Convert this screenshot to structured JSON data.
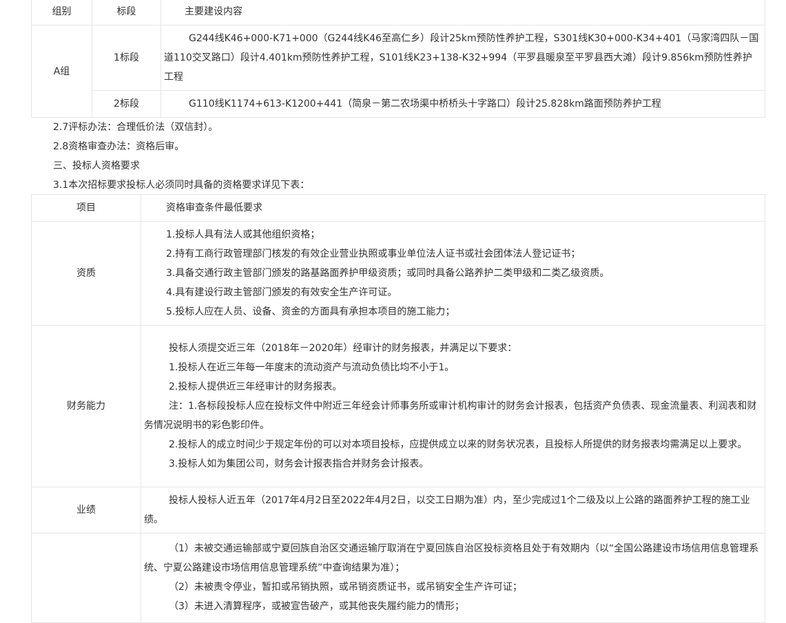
{
  "table1": {
    "headers": [
      "组别",
      "标段",
      "主要建设内容"
    ],
    "group": "A组",
    "rows": [
      {
        "section": "1标段",
        "content": "G244线K46+000-K71+000（G244线K46至高仁乡）段计25km预防性养护工程，S301线K30+000-K34+401（马家湾四队－国道110交叉路口）段计4.401km预防性养护工程，S101线K23+138-K32+994（平罗县暖泉至平罗县西大滩）段计9.856km预防性养护工程"
      },
      {
        "section": "2标段",
        "content": "G110线K1174+613-K1200+441（简泉－第二农场渠中桥桥头十字路口）段计25.828km路面预防养护工程"
      }
    ]
  },
  "paragraphs": [
    "2.7评标办法：合理低价法（双信封）。",
    "2.8资格审查办法：资格后审。",
    "三、投标人资格要求",
    "3.1本次招标要求投标人必须同时具备的资格要求详见下表："
  ],
  "table2": {
    "headers": [
      "项目",
      "资格审查条件最低要求"
    ],
    "rows": [
      {
        "item": "资质",
        "lines": [
          "1.投标人具有法人或其他组织资格；",
          "2.持有工商行政管理部门核发的有效企业营业执照或事业单位法人证书或社会团体法人登记证书；",
          "3.具备交通行政主管部门颁发的路基路面养护甲级资质；或同时具备公路养护二类甲级和二类乙级资质。",
          "4.具有建设行政主管部门颁发的有效安全生产许可证。",
          "5.投标人应在人员、设备、资金的方面具有承担本项目的施工能力；"
        ]
      },
      {
        "item": "财务能力",
        "lines": [
          "投标人须提交近三年（2018年－2020年）经审计的财务报表，并满足以下要求：",
          "1.投标人在近三年每一年度末的流动资产与流动负债比均不小于1。",
          "2.投标人提供近三年经审计的财务报表。",
          "注：1.各标段投标人应在投标文件中附近三年经会计师事务所或审计机构审计的财务会计报表，包括资产负债表、现金流量表、利润表和财务情况说明书的彩色影印件。",
          "2.投标人的成立时间少于规定年份的可以对本项目投标，应提供成立以来的财务状况表，且投标人所提供的财务报表均需满足以上要求。",
          "3.投标人如为集团公司，财务会计报表指合并财务会计报表。"
        ]
      },
      {
        "item": "业绩",
        "lines": [
          "投标人投标人近五年（2017年4月2日至2022年4月2日，以交工日期为准）内，至少完成过1个二级及以上公路的路面养护工程的施工业绩。"
        ]
      },
      {
        "item": "",
        "lines": [
          "（1）未被交通运输部或宁夏回族自治区交通运输厅取消在宁夏回族自治区投标资格且处于有效期内（以“全国公路建设市场信用信息管理系统、宁夏公路建设市场信用信息管理系统”中查询结果为准）；",
          "（2）未被责令停业，暂扣或吊销执照，或吊销资质证书，或吊销安全生产许可证；",
          "（3）未进入清算程序，或被宣告破产，或其他丧失履约能力的情形；"
        ]
      }
    ]
  }
}
